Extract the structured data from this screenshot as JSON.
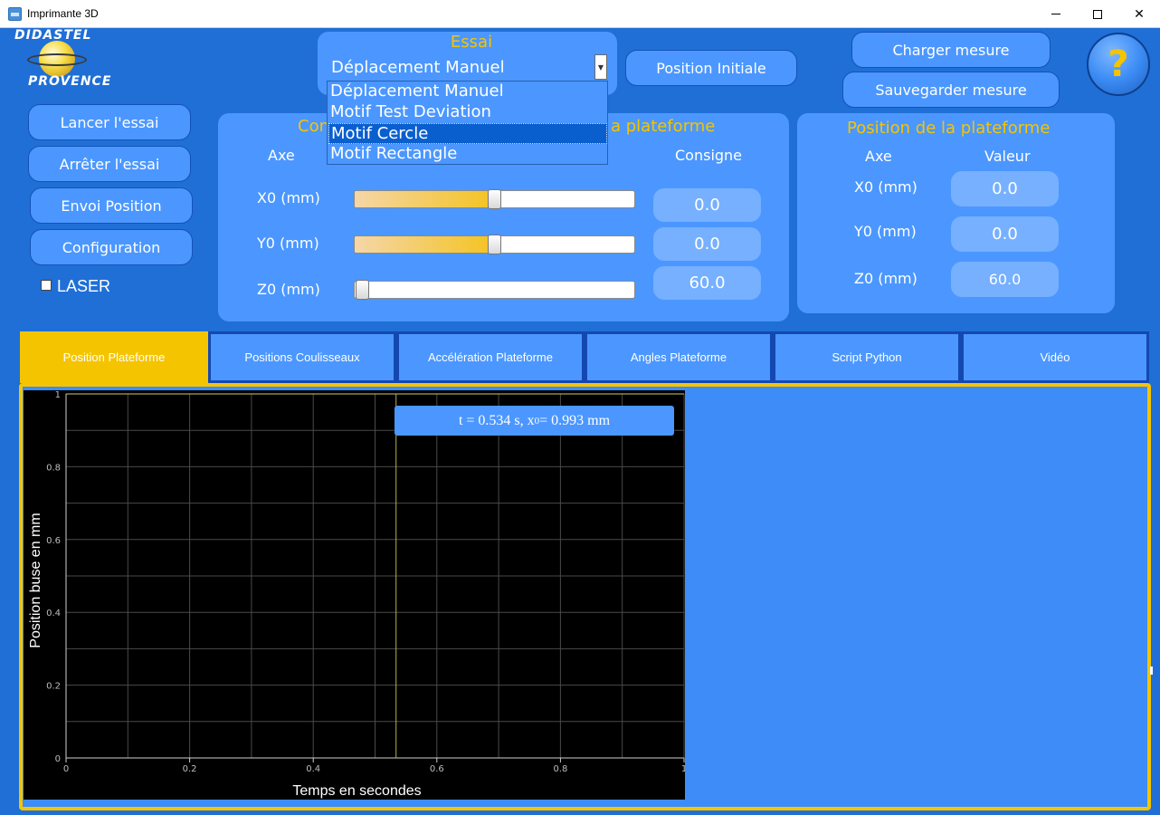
{
  "window": {
    "title": "Imprimante 3D",
    "minimize": "",
    "maximize": "",
    "close": "✕"
  },
  "logo": {
    "top_text": "DIDASTEL",
    "bottom_text": "PROVENCE"
  },
  "left_buttons": {
    "lancer": "Lancer l'essai",
    "arreter": "Arrêter l'essai",
    "envoi": "Envoi Position",
    "config": "Configuration"
  },
  "laser": {
    "label": "LASER",
    "checked": false
  },
  "essai": {
    "title": "Essai",
    "selected": "Déplacement Manuel",
    "options": [
      "Déplacement Manuel",
      "Motif Test Deviation",
      "Motif Cercle",
      "Motif Rectangle"
    ],
    "highlighted_option": "Motif Cercle"
  },
  "top_buttons": {
    "position_initiale": "Position Initiale",
    "charger": "Charger mesure",
    "sauvegarder": "Sauvegarder mesure",
    "help": "?"
  },
  "consigne_panel": {
    "title_left": "Con",
    "title_right": "a plateforme",
    "col_axe": "Axe",
    "col_consigne": "Consigne",
    "rows": [
      {
        "label": "X0 (mm)",
        "value": "0.0",
        "slider_fraction": 0.5
      },
      {
        "label": "Y0 (mm)",
        "value": "0.0",
        "slider_fraction": 0.5
      },
      {
        "label": "Z0 (mm)",
        "value": "60.0",
        "slider_fraction": 0.0
      }
    ]
  },
  "position_panel": {
    "title": "Position de la plateforme",
    "col_axe": "Axe",
    "col_valeur": "Valeur",
    "rows": [
      {
        "label": "X0 (mm)",
        "value": "0.0"
      },
      {
        "label": "Y0 (mm)",
        "value": "0.0"
      },
      {
        "label": "Z0 (mm)",
        "value": "60.0"
      }
    ]
  },
  "tabs": [
    {
      "label": "Position Plateforme",
      "active": true
    },
    {
      "label": "Positions Coulisseaux",
      "active": false
    },
    {
      "label": "Accélération Plateforme",
      "active": false
    },
    {
      "label": "Angles Plateforme",
      "active": false
    },
    {
      "label": "Script Python",
      "active": false
    },
    {
      "label": "Vidéo",
      "active": false
    }
  ],
  "tooltip": {
    "prefix": "t = 0.534 s, x",
    "sub": "0",
    "suffix": " = 0.993 mm"
  },
  "colors": {
    "accent": "#f5c400",
    "panel": "#4b97ff",
    "background": "#1f6fd6",
    "value_box": "#76b0ff"
  },
  "chart_data": {
    "type": "line",
    "title": "",
    "xlabel": "Temps en secondes",
    "ylabel": "Position buse en mm",
    "xlim": [
      0,
      1
    ],
    "ylim": [
      0,
      1
    ],
    "x_ticks": [
      "0",
      "0.2",
      "0.4",
      "0.6",
      "0.8",
      "1"
    ],
    "y_ticks": [
      "0",
      "0.2",
      "0.4",
      "0.6",
      "0.8",
      "1"
    ],
    "grid": true,
    "series": [
      {
        "x": [
          0,
          1
        ],
        "y": [
          1,
          1
        ]
      }
    ],
    "cursor_x": 0.534,
    "background": "#000000"
  }
}
